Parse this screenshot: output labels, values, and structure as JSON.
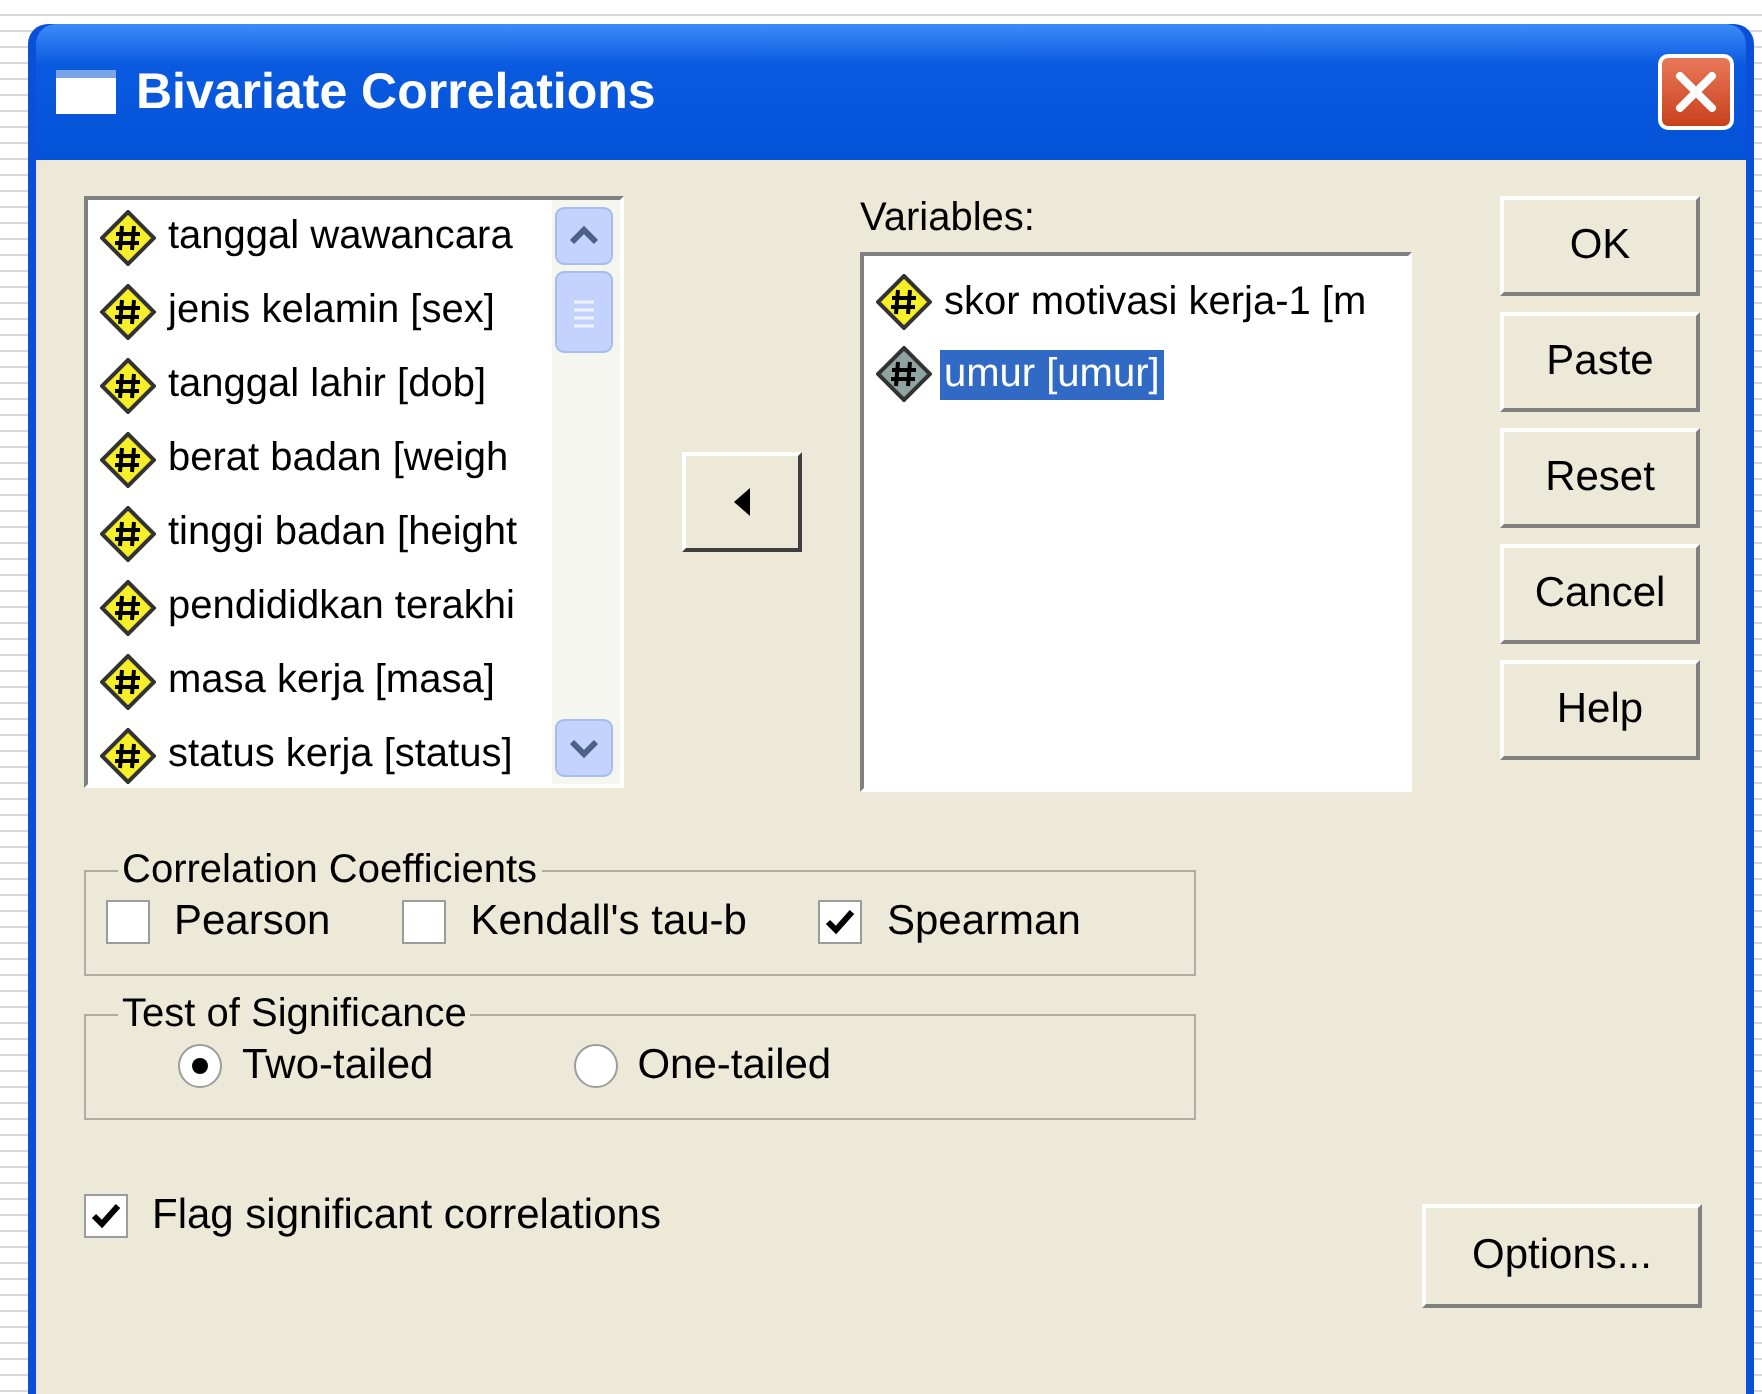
{
  "window": {
    "title": "Bivariate Correlations"
  },
  "source_list": {
    "items": [
      {
        "label": "tanggal wawancara",
        "selected": false
      },
      {
        "label": "jenis kelamin [sex]",
        "selected": false
      },
      {
        "label": "tanggal lahir [dob]",
        "selected": false
      },
      {
        "label": "berat badan [weigh",
        "selected": false
      },
      {
        "label": "tinggi badan [height",
        "selected": false
      },
      {
        "label": "pendididkan terakhi",
        "selected": false
      },
      {
        "label": "masa kerja [masa]",
        "selected": false
      },
      {
        "label": "status kerja [status]",
        "selected": false
      }
    ]
  },
  "variables": {
    "label": "Variables:",
    "items": [
      {
        "label": "skor motivasi kerja-1 [m",
        "selected": false
      },
      {
        "label": "umur [umur]",
        "selected": true
      }
    ]
  },
  "buttons": [
    "OK",
    "Paste",
    "Reset",
    "Cancel",
    "Help"
  ],
  "correlation_coefficients": {
    "title": "Correlation Coefficients",
    "options": [
      {
        "label": "Pearson",
        "checked": false
      },
      {
        "label": "Kendall's tau-b",
        "checked": false
      },
      {
        "label": "Spearman",
        "checked": true
      }
    ]
  },
  "test_of_significance": {
    "title": "Test of Significance",
    "options": [
      {
        "label": "Two-tailed",
        "selected": true
      },
      {
        "label": "One-tailed",
        "selected": false
      }
    ]
  },
  "flag_significant": {
    "label": "Flag significant correlations",
    "checked": true
  },
  "options_button": "Options..."
}
